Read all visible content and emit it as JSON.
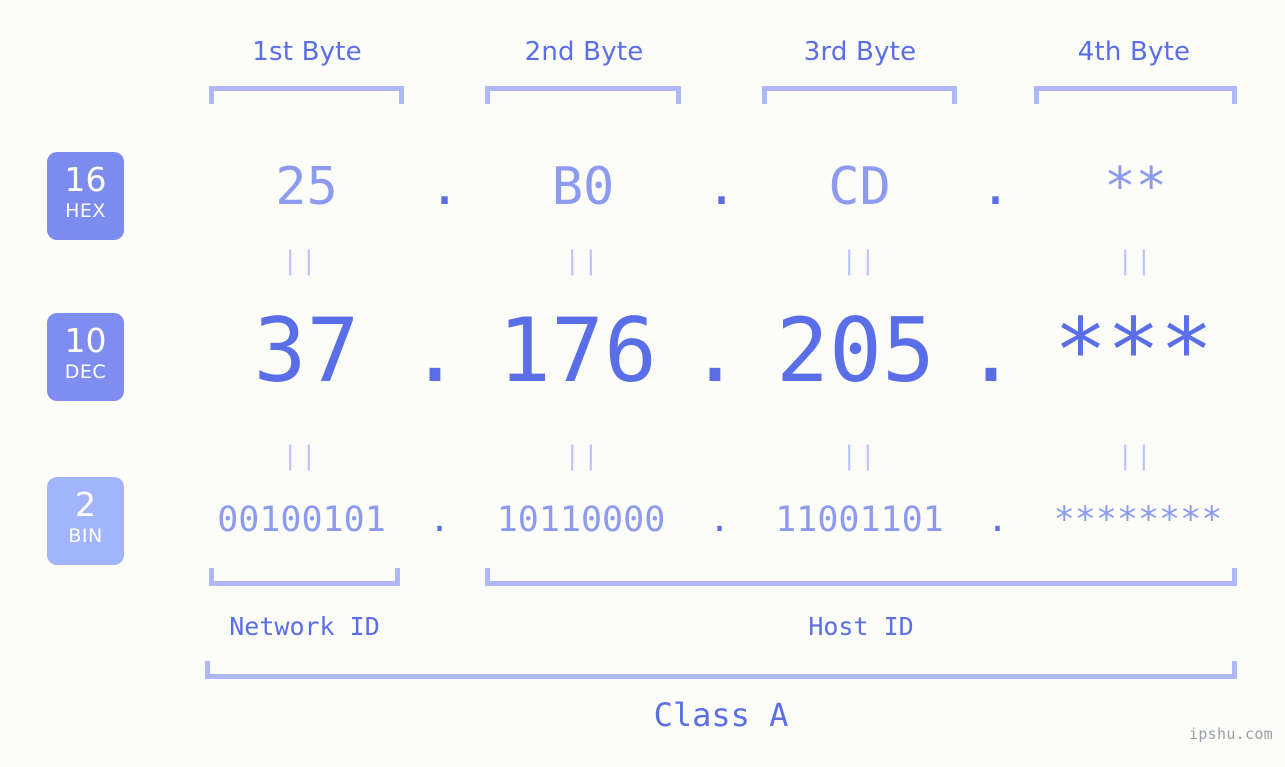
{
  "page": {
    "background_color": "#fcfdf9",
    "accent_strong": "#5a6ee8",
    "accent_light": "#8c9bef",
    "accent_pale": "#aeb8f9",
    "watermark": "ipshu.com"
  },
  "header": {
    "byte_labels": [
      "1st Byte",
      "2nd Byte",
      "3rd Byte",
      "4th Byte"
    ]
  },
  "bases": [
    {
      "num": "16",
      "name": "HEX",
      "color": "#7b8bee"
    },
    {
      "num": "10",
      "name": "DEC",
      "color": "#7f8df0"
    },
    {
      "num": "2",
      "name": "BIN",
      "color": "#a2b4fb"
    }
  ],
  "rows": {
    "hex": {
      "values": [
        "25",
        "B0",
        "CD",
        "**"
      ],
      "separators": [
        ".",
        ".",
        "."
      ]
    },
    "dec": {
      "values": [
        "37",
        "176",
        "205",
        "***"
      ],
      "separators": [
        ".",
        ".",
        "."
      ]
    },
    "bin": {
      "values": [
        "00100101",
        "10110000",
        "11001101",
        "********"
      ],
      "separators": [
        ".",
        ".",
        "."
      ]
    }
  },
  "equals": {
    "glyph": "||",
    "hex_to_dec": [
      "||",
      "||",
      "||",
      "||"
    ],
    "dec_to_bin": [
      "||",
      "||",
      "||",
      "||"
    ]
  },
  "footer": {
    "network_id_label": "Network ID",
    "host_id_label": "Host ID",
    "class_label": "Class A"
  }
}
